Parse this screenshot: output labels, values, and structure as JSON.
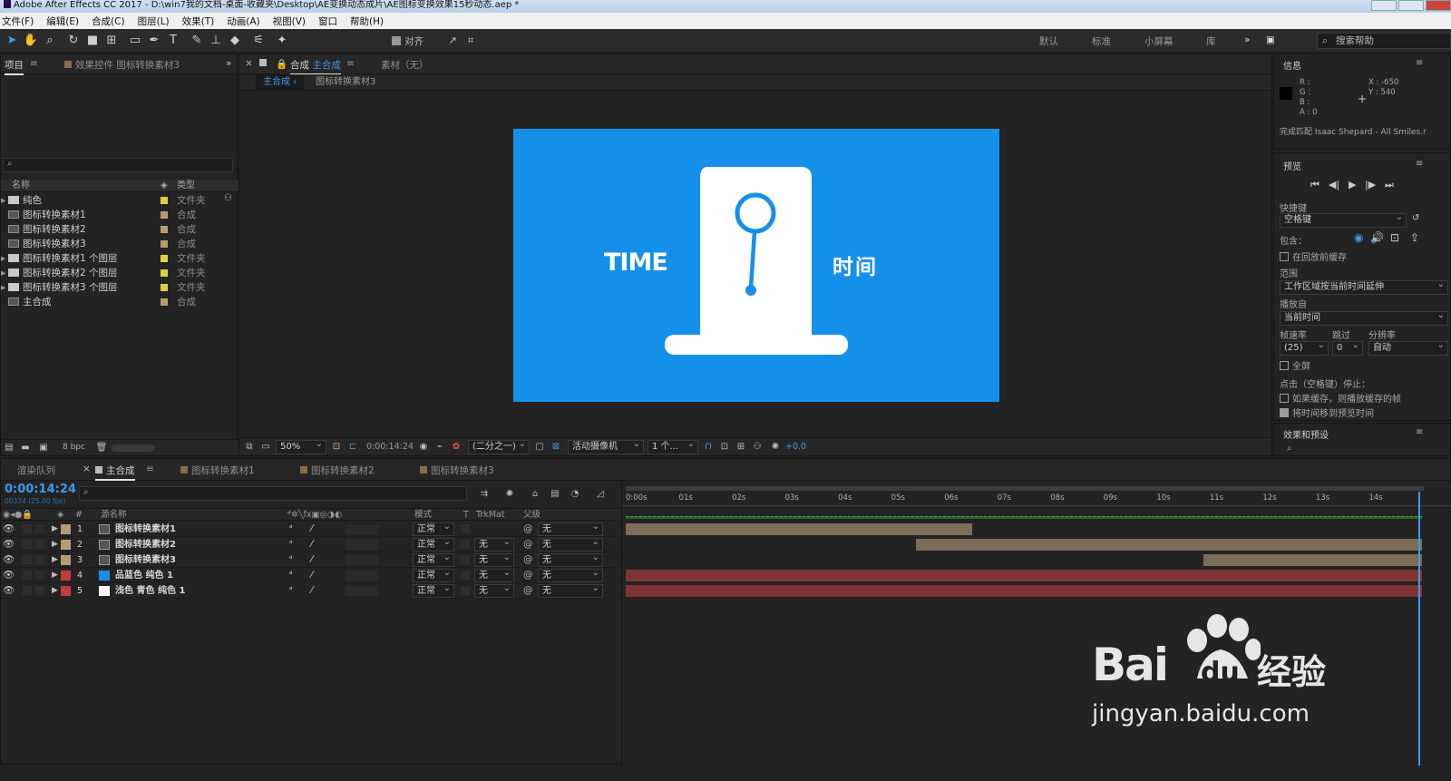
{
  "window": {
    "title": "Adobe After Effects CC 2017 - D:\\win7我的文档-桌面-收藏夹\\Desktop\\AE变换动态成片\\AE图标变换效果15秒动态.aep *"
  },
  "menu": [
    "文件(F)",
    "编辑(E)",
    "合成(C)",
    "图层(L)",
    "效果(T)",
    "动画(A)",
    "视图(V)",
    "窗口",
    "帮助(H)"
  ],
  "toolbar": {
    "align_label": "对齐",
    "workspaces": [
      "默认",
      "标准",
      "小屏幕",
      "库"
    ],
    "search_help_placeholder": "搜索帮助"
  },
  "project_panel": {
    "tab_label": "项目",
    "effects_tab_label": "效果控件 图标转换素材3",
    "col_name": "名称",
    "col_type": "类型",
    "bpc_label": "8 bpc",
    "items": [
      {
        "name": "纯色",
        "type": "文件夹",
        "kind": "folder",
        "color": "#e0d040"
      },
      {
        "name": "图标转换素材1",
        "type": "合成",
        "kind": "comp",
        "color": "#b89c70"
      },
      {
        "name": "图标转换素材2",
        "type": "合成",
        "kind": "comp",
        "color": "#b89c70"
      },
      {
        "name": "图标转换素材3",
        "type": "合成",
        "kind": "comp",
        "color": "#b89c70"
      },
      {
        "name": "图标转换素材1 个图层",
        "type": "文件夹",
        "kind": "folder",
        "color": "#e0d040"
      },
      {
        "name": "图标转换素材2 个图层",
        "type": "文件夹",
        "kind": "folder",
        "color": "#e0d040"
      },
      {
        "name": "图标转换素材3 个图层",
        "type": "文件夹",
        "kind": "folder",
        "color": "#e0d040"
      },
      {
        "name": "主合成",
        "type": "合成",
        "kind": "comp",
        "color": "#b89c70"
      }
    ]
  },
  "comp_viewer": {
    "tab_prefix": "合成",
    "tab_name": "主合成",
    "footage_tab": "素材（无）",
    "breadcrumb_1": "主合成",
    "breadcrumb_2": "图标转换素材3",
    "canvas": {
      "bg_color": "#1590ea",
      "left_text": "TIME",
      "right_text": "时间"
    },
    "footer": {
      "zoom": "50%",
      "timecode": "0:00:14:24",
      "resolution": "(二分之一)",
      "camera": "活动摄像机",
      "views": "1 个...",
      "exposure": "+0.0"
    }
  },
  "info_panel": {
    "title": "信息",
    "r": "R :",
    "g": "G :",
    "b": "B :",
    "a": "A : 0",
    "x": "X : -650",
    "y": "Y : 540",
    "status": "完成匹配 Isaac Shepard - All Smiles.r"
  },
  "preview_panel": {
    "title": "预览",
    "shortcut_label": "快捷键",
    "shortcut_value": "空格键",
    "include_label": "包含：",
    "cache_before": "在回放前缓存",
    "range_label": "范围",
    "range_value": "工作区域按当前时间延伸",
    "play_from_label": "播放自",
    "play_from_value": "当前时间",
    "framerate_label": "帧速率",
    "skip_label": "跳过",
    "resolution_label": "分辨率",
    "framerate_value": "(25)",
    "skip_value": "0",
    "resolution_value": "自动",
    "fullscreen_label": "全屏",
    "stop_label": "点击（空格键）停止：",
    "opt_cache": "如果缓存，则播放缓存的帧",
    "opt_move_time": "将时间移到预览时间"
  },
  "effects_panel": {
    "title": "效果和预设"
  },
  "timeline": {
    "tabs": [
      "渲染队列",
      "主合成",
      "图标转换素材1",
      "图标转换素材2",
      "图标转换素材3"
    ],
    "timecode": "0:00:14:24",
    "fps_info": "00374 (25.00 fps)",
    "col_source": "源名称",
    "col_mode": "模式",
    "col_t": "T",
    "col_trkmat": "TrkMat",
    "col_parent": "父级",
    "ruler": [
      "0:00s",
      "01s",
      "02s",
      "03s",
      "04s",
      "05s",
      "06s",
      "07s",
      "08s",
      "09s",
      "10s",
      "11s",
      "12s",
      "13s",
      "14s"
    ],
    "layers": [
      {
        "num": "1",
        "name": "图标转换素材1",
        "label": "#b89c70",
        "icon": "comp",
        "mode": "正常",
        "trkmat": "",
        "parent": "无",
        "bar_start": 0.0,
        "bar_end": 0.435,
        "bar_color": "#7d6d58"
      },
      {
        "num": "2",
        "name": "图标转换素材2",
        "label": "#b89c70",
        "icon": "comp",
        "mode": "正常",
        "trkmat": "无",
        "parent": "无",
        "bar_start": 0.365,
        "bar_end": 1.0,
        "bar_color": "#7d6d58"
      },
      {
        "num": "3",
        "name": "图标转换素材3",
        "label": "#b89c70",
        "icon": "comp",
        "mode": "正常",
        "trkmat": "无",
        "parent": "无",
        "bar_start": 0.725,
        "bar_end": 1.0,
        "bar_color": "#7d6d58"
      },
      {
        "num": "4",
        "name": "品蓝色 纯色 1",
        "label": "#c03c3c",
        "icon": "solid-blue",
        "mode": "正常",
        "trkmat": "无",
        "parent": "无",
        "bar_start": 0.0,
        "bar_end": 1.0,
        "bar_color": "#7e3434"
      },
      {
        "num": "5",
        "name": "浅色 青色 纯色 1",
        "label": "#c03c3c",
        "icon": "solid-white",
        "mode": "正常",
        "trkmat": "无",
        "parent": "无",
        "bar_start": 0.0,
        "bar_end": 1.0,
        "bar_color": "#7e3434"
      }
    ]
  },
  "watermark": {
    "brand": "Bai",
    "brand2": "du",
    "cn": "经验",
    "url": "jingyan.baidu.com"
  }
}
